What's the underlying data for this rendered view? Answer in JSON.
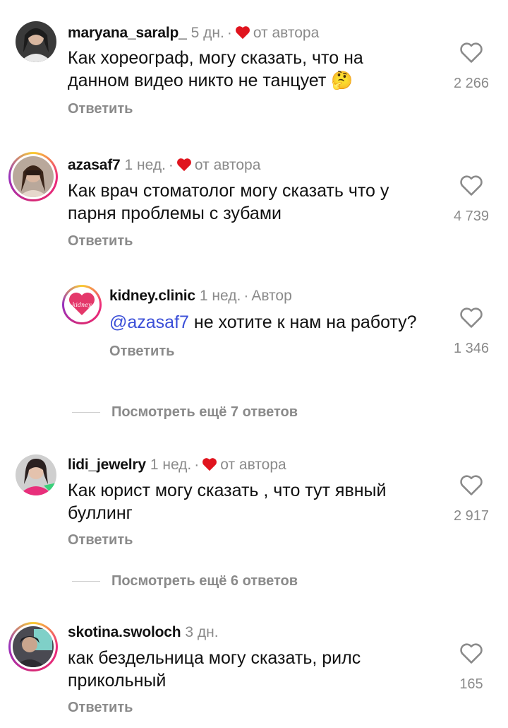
{
  "heart_color": "#e0141e",
  "comments": [
    {
      "username": "maryana_saralp_",
      "time": "5 дн.",
      "dot": "·",
      "author_like": "от автора",
      "text": "Как хореограф, могу сказать, что на данном видео никто не танцует",
      "emoji": "🤔",
      "reply": "Ответить",
      "likes": "2 266",
      "avatar_icon": "avatar-photo"
    },
    {
      "username": "azasaf7",
      "time": "1 нед.",
      "dot": "·",
      "author_like": "от автора",
      "text": "Как врач стоматолог могу сказать что у парня проблемы с зубами",
      "reply": "Ответить",
      "likes": "4 739",
      "avatar_icon": "avatar-photo"
    },
    {
      "username": "kidney.clinic",
      "time": "1 нед.",
      "dot": "·",
      "badge": "Автор",
      "mention": "@azasaf7",
      "text": " не хотите к нам на работу?",
      "reply": "Ответить",
      "likes": "1 346",
      "avatar_logo_text": "kidney"
    },
    {
      "username": "lidi_jewelry",
      "time": "1 нед.",
      "dot": "·",
      "author_like": "от автора",
      "text": "Как юрист могу сказать , что тут явный буллинг",
      "reply": "Ответить",
      "likes": "2 917",
      "avatar_icon": "avatar-photo"
    },
    {
      "username": "skotina.swoloch",
      "time": "3 дн.",
      "text": "как бездельница могу сказать, рилс прикольный",
      "reply": "Ответить",
      "likes": "165",
      "avatar_icon": "avatar-photo"
    }
  ],
  "more_replies": [
    {
      "label": "Посмотреть ещё 7 ответов"
    },
    {
      "label": "Посмотреть ещё 6 ответов"
    }
  ]
}
